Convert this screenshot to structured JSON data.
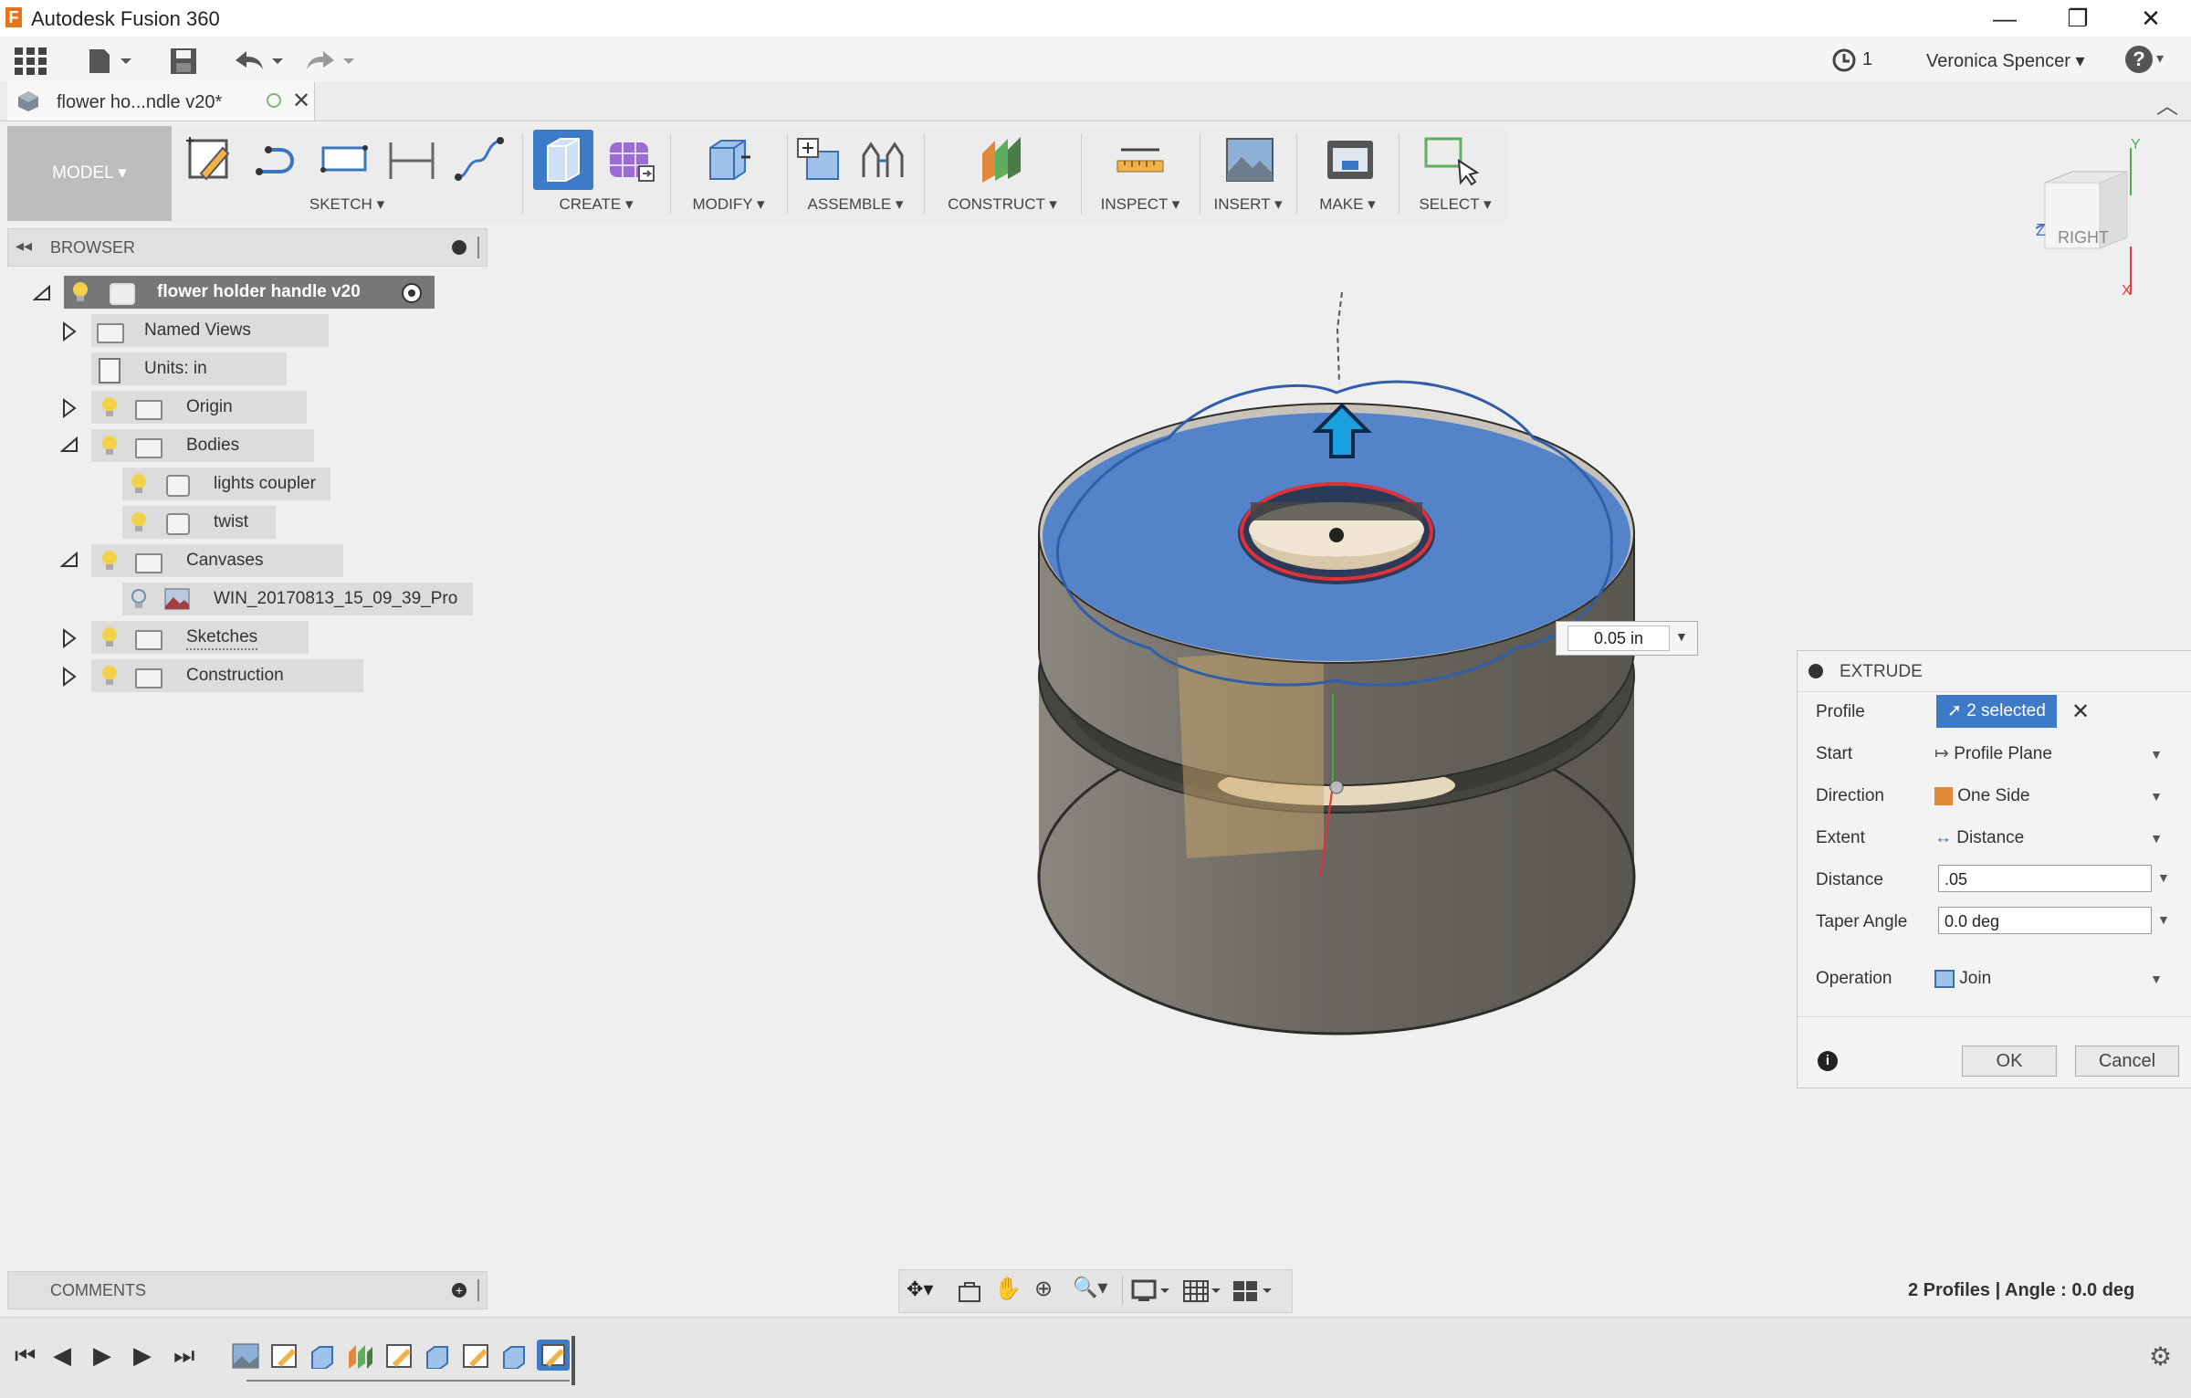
{
  "app": {
    "title": "Autodesk Fusion 360"
  },
  "window_controls": {
    "minimize": "—",
    "restore": "❐",
    "close": "✕"
  },
  "quick_access": {
    "jobs_count": "1",
    "user": "Veronica Spencer",
    "help": "?"
  },
  "document_tab": {
    "name": "flower ho...ndle v20*"
  },
  "ribbon": {
    "workspace": "MODEL",
    "groups": [
      {
        "label": "SKETCH"
      },
      {
        "label": "CREATE"
      },
      {
        "label": "MODIFY"
      },
      {
        "label": "ASSEMBLE"
      },
      {
        "label": "CONSTRUCT"
      },
      {
        "label": "INSPECT"
      },
      {
        "label": "INSERT"
      },
      {
        "label": "MAKE"
      },
      {
        "label": "SELECT"
      }
    ]
  },
  "browser": {
    "title": "BROWSER",
    "root": "flower holder handle v20",
    "items": [
      {
        "label": "Named Views"
      },
      {
        "label": "Units: in"
      },
      {
        "label": "Origin"
      },
      {
        "label": "Bodies"
      },
      {
        "label": "lights coupler"
      },
      {
        "label": "twist"
      },
      {
        "label": "Canvases"
      },
      {
        "label": "WIN_20170813_15_09_39_Pro"
      },
      {
        "label": "Sketches"
      },
      {
        "label": "Construction"
      }
    ]
  },
  "viewcube": {
    "face": "RIGHT",
    "axis_y": "Y",
    "axis_z": "Z",
    "axis_x": "X"
  },
  "dimension": {
    "value": "0.05 in"
  },
  "extrude": {
    "title": "EXTRUDE",
    "rows": {
      "profile": {
        "label": "Profile",
        "value": "2 selected"
      },
      "start": {
        "label": "Start",
        "value": "Profile Plane"
      },
      "direction": {
        "label": "Direction",
        "value": "One Side"
      },
      "extent": {
        "label": "Extent",
        "value": "Distance"
      },
      "distance": {
        "label": "Distance",
        "value": ".05"
      },
      "taper": {
        "label": "Taper Angle",
        "value": "0.0 deg"
      },
      "operation": {
        "label": "Operation",
        "value": "Join"
      }
    },
    "ok": "OK",
    "cancel": "Cancel"
  },
  "comments": {
    "title": "COMMENTS"
  },
  "status": {
    "text": "2 Profiles | Angle : 0.0 deg"
  },
  "colors": {
    "accent": "#3a7bd5",
    "selection_blue": "#4f7fc9",
    "body_gray": "#6b6862"
  }
}
